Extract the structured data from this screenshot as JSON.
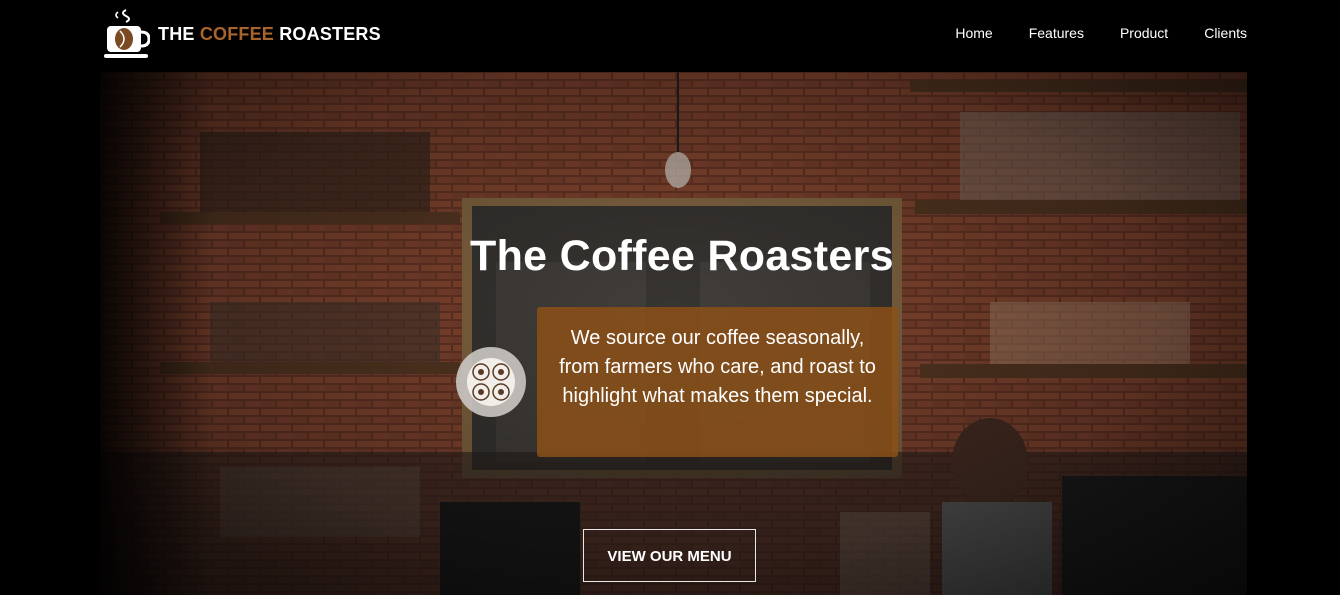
{
  "brand": {
    "prefix": "THE",
    "accent": "COFFEE",
    "suffix": "ROASTERS",
    "accent_color": "#a8642a"
  },
  "nav": {
    "items": [
      "Home",
      "Features",
      "Product",
      "Clients"
    ]
  },
  "hero": {
    "title": "The Coffee Roasters",
    "tagline": "We source our coffee seasonally, from farmers who care, and roast to highlight what makes them special.",
    "cta_label": "VIEW OUR MENU",
    "box_color": "#8c5018"
  },
  "icons": {
    "logo": "coffee-cup-logo-icon",
    "badge": "coffee-badge-icon"
  }
}
